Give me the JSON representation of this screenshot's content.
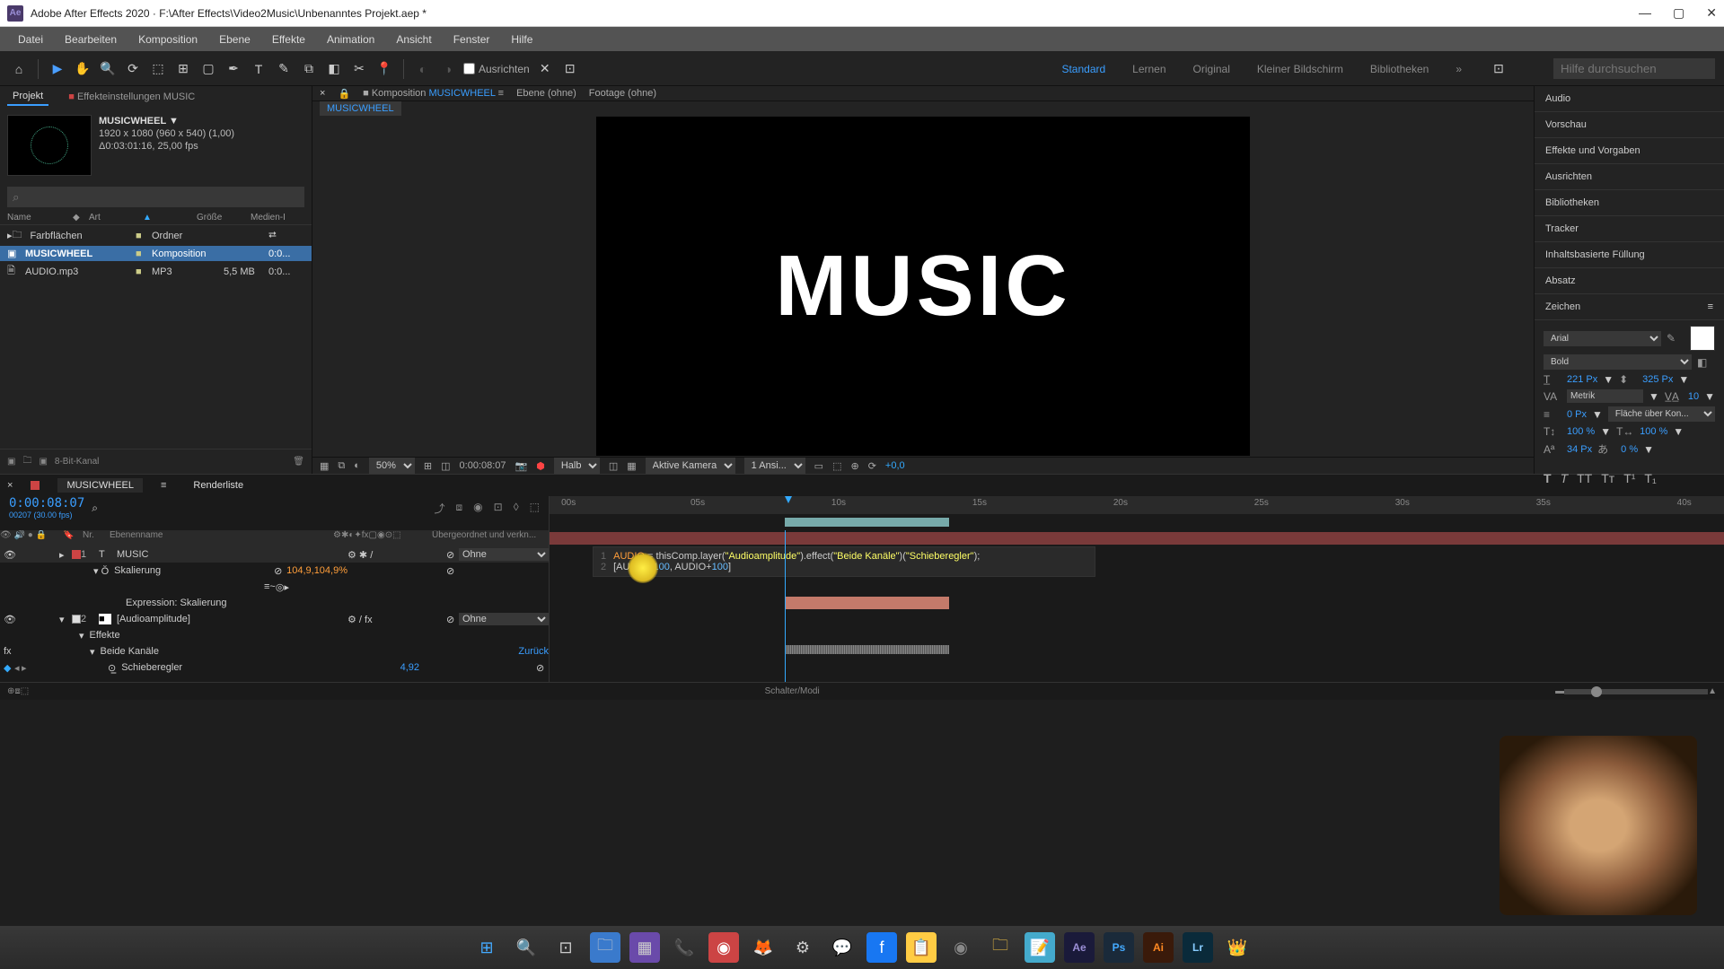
{
  "titlebar": {
    "app": "Adobe After Effects 2020",
    "path": "F:\\After Effects\\Video2Music\\Unbenanntes Projekt.aep *"
  },
  "menubar": [
    "Datei",
    "Bearbeiten",
    "Komposition",
    "Ebene",
    "Effekte",
    "Animation",
    "Ansicht",
    "Fenster",
    "Hilfe"
  ],
  "toolbar": {
    "ausrichten": "Ausrichten",
    "workspaces": [
      "Standard",
      "Lernen",
      "Original",
      "Kleiner Bildschirm",
      "Bibliotheken"
    ],
    "search_placeholder": "Hilfe durchsuchen"
  },
  "project_panel": {
    "tabs": {
      "project": "Projekt",
      "effects": "Effekteinstellungen  MUSIC"
    },
    "comp_name": "MUSICWHEEL",
    "meta1": "1920 x 1080 (960 x 540) (1,00)",
    "meta2": "Δ0:03:01:16, 25,00 fps",
    "columns": {
      "name": "Name",
      "art": "Art",
      "size": "Größe",
      "media": "Medien-I"
    },
    "items": [
      {
        "name": "Farbflächen",
        "art": "Ordner",
        "size": "",
        "media": ""
      },
      {
        "name": "MUSICWHEEL",
        "art": "Komposition",
        "size": "",
        "media": "0:0..."
      },
      {
        "name": "AUDIO.mp3",
        "art": "MP3",
        "size": "5,5 MB",
        "media": "0:0..."
      }
    ],
    "footer": "8-Bit-Kanal"
  },
  "comp_panel": {
    "tabs": {
      "comp": "Komposition",
      "compname": "MUSICWHEEL",
      "layer": "Ebene (ohne)",
      "footage": "Footage (ohne)"
    },
    "crumb": "MUSICWHEEL",
    "text": "MUSIC",
    "footer": {
      "zoom": "50%",
      "time": "0:00:08:07",
      "res": "Halb",
      "camera": "Aktive Kamera",
      "views": "1 Ansi...",
      "offset": "+0,0"
    }
  },
  "right_panels": [
    "Audio",
    "Vorschau",
    "Effekte und Vorgaben",
    "Ausrichten",
    "Bibliotheken",
    "Tracker",
    "Inhaltsbasierte Füllung",
    "Absatz",
    "Zeichen"
  ],
  "char_panel": {
    "font": "Arial",
    "style": "Bold",
    "size": "221 Px",
    "leading": "325 Px",
    "kerning": "Metrik",
    "tracking": "10",
    "stroke": "0 Px",
    "stroke_mode": "Fläche über Kon...",
    "vscale": "100 %",
    "hscale": "100 %",
    "baseline": "34 Px",
    "tsume": "0 %"
  },
  "timeline": {
    "tabs": {
      "comp": "MUSICWHEEL",
      "render": "Renderliste"
    },
    "timecode": "0:00:08:07",
    "fps": "00207 (30.00 fps)",
    "col_header": {
      "nr": "Nr.",
      "name": "Ebenenname",
      "parent": "Übergeordnet und verkn..."
    },
    "parent_none": "Ohne",
    "layers": [
      {
        "num": "1",
        "name": "MUSIC",
        "color": "#c44"
      },
      {
        "num": "2",
        "name": "[Audioamplitude]",
        "color": "#ddd"
      }
    ],
    "props": {
      "scaling": "Skalierung",
      "scaling_val": "104,9,104,9%",
      "expr_label": "Expression: Skalierung",
      "effects": "Effekte",
      "both_ch": "Beide Kanäle",
      "slider": "Schieberegler",
      "back": "Zurück",
      "slider_val": "4,92"
    },
    "expression": {
      "line1_a": "AUDIO",
      "line1_b": "= thisComp.layer(",
      "line1_c": "\"Audioamplitude\"",
      "line1_d": ").effect(",
      "line1_e": "\"Beide Kanäle\"",
      "line1_f": ")(",
      "line1_g": "\"Schieberegler\"",
      "line1_h": ");",
      "line2_a": "[AUDIO+",
      "line2_b": "100",
      "line2_c": ", AUDIO+",
      "line2_d": "100",
      "line2_e": "]"
    },
    "ruler": [
      "00s",
      "05s",
      "10s",
      "15s",
      "20s",
      "25s",
      "30s",
      "35s",
      "40s"
    ],
    "footer": "Schalter/Modi"
  }
}
